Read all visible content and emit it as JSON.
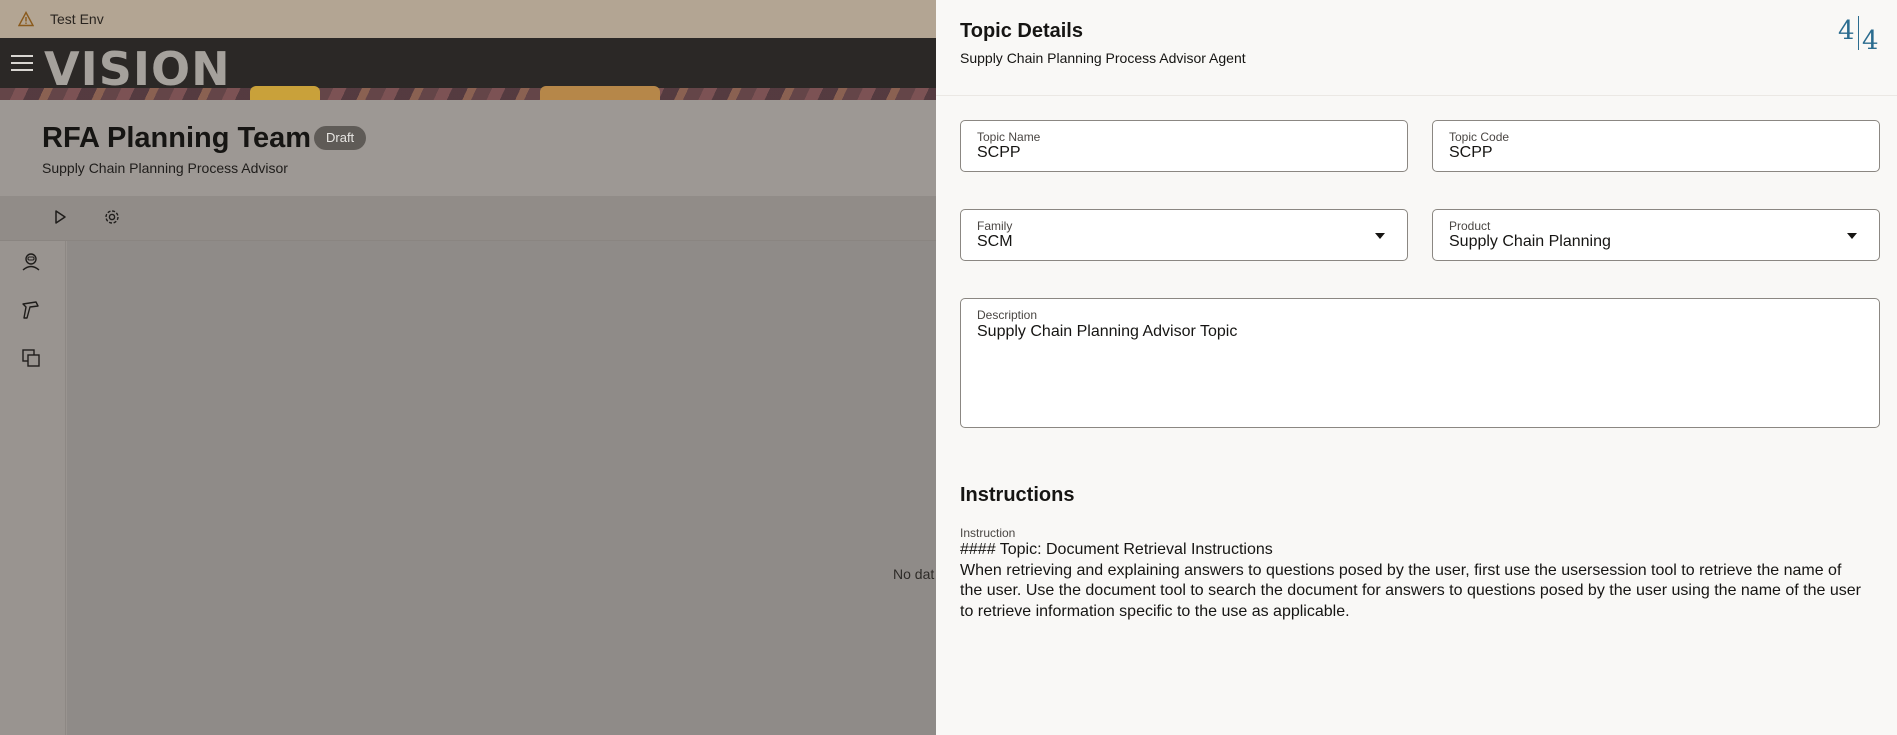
{
  "env": {
    "label": "Test Env",
    "icon": "warning-icon"
  },
  "brand": {
    "logo": "VISION",
    "menu_icon": "hamburger-menu-icon"
  },
  "page": {
    "title": "RFA Planning Team",
    "badge": "Draft",
    "subtitle": "Supply Chain Planning Process Advisor",
    "empty_text": "No dat"
  },
  "toolbar": {
    "icons": [
      "play-icon",
      "gear-icon"
    ]
  },
  "rail": {
    "icons": [
      "agent-icon",
      "tools-icon",
      "copy-icon"
    ]
  },
  "drawer": {
    "title": "Topic Details",
    "subtitle": "Supply Chain Planning Process Advisor Agent",
    "logo_left": "4",
    "logo_right": "4",
    "fields": {
      "topic_name": {
        "label": "Topic Name",
        "value": "SCPP"
      },
      "topic_code": {
        "label": "Topic Code",
        "value": "SCPP"
      },
      "family": {
        "label": "Family",
        "value": "SCM"
      },
      "product": {
        "label": "Product",
        "value": "Supply Chain Planning"
      },
      "description": {
        "label": "Description",
        "value": "Supply Chain Planning Advisor Topic"
      }
    },
    "instructions": {
      "heading": "Instructions",
      "label": "Instruction",
      "lines": [
        "#### Topic: Document Retrieval Instructions",
        "When retrieving and explaining answers to questions posed by the user, first use the usersession tool to retrieve the name of",
        "the user. Use the document tool to search the document for answers to questions posed by the user using the name of the user",
        "to retrieve information specific to the use as applicable."
      ]
    }
  },
  "colors": {
    "accent_logo": "#2b6c8f",
    "drawer_bg": "#f9f8f6",
    "overlay_bg": "#999490"
  }
}
